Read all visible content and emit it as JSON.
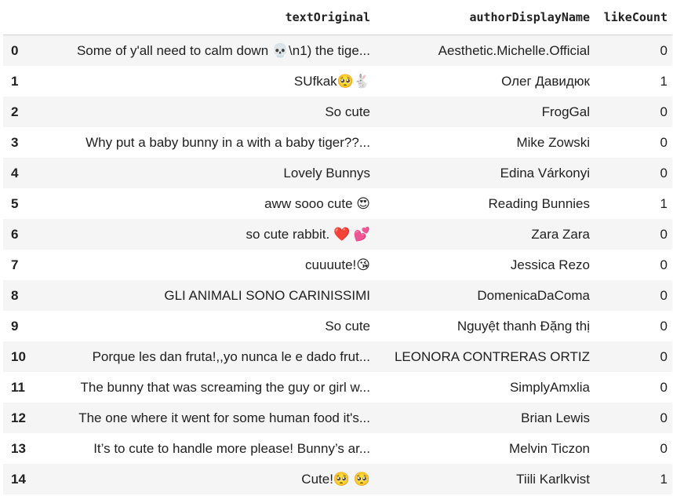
{
  "columns": {
    "index": "",
    "text": "textOriginal",
    "author": "authorDisplayName",
    "likes": "likeCount"
  },
  "rows": [
    {
      "index": "0",
      "text": "Some of y'all need to calm down 💀\\n1) the tige...",
      "author": "Aesthetic.Michelle.Official",
      "likes": "0"
    },
    {
      "index": "1",
      "text": "SUfkak🥺🐇",
      "author": "Олег Давидюк",
      "likes": "1"
    },
    {
      "index": "2",
      "text": "So cute",
      "author": "FrogGal",
      "likes": "0"
    },
    {
      "index": "3",
      "text": "Why put a baby bunny in a with a baby tiger??...",
      "author": "Mike Zowski",
      "likes": "0"
    },
    {
      "index": "4",
      "text": "Lovely Bunnys",
      "author": "Edina Várkonyi",
      "likes": "0"
    },
    {
      "index": "5",
      "text": "aww sooo cute 😍",
      "author": "Reading Bunnies",
      "likes": "1"
    },
    {
      "index": "6",
      "text": "so cute rabbit. ❤️ 💕",
      "author": "Zara Zara",
      "likes": "0"
    },
    {
      "index": "7",
      "text": "cuuuute!😘",
      "author": "Jessica Rezo",
      "likes": "0"
    },
    {
      "index": "8",
      "text": "GLI ANIMALI SONO CARINISSIMI",
      "author": "DomenicaDaComa",
      "likes": "0"
    },
    {
      "index": "9",
      "text": "So cute",
      "author": "Nguyệt thanh Đặng thị",
      "likes": "0"
    },
    {
      "index": "10",
      "text": "Porque les dan fruta!,,yo nunca le e dado frut...",
      "author": "LEONORA CONTRERAS ORTIZ",
      "likes": "0"
    },
    {
      "index": "11",
      "text": "The bunny that was screaming the guy or girl w...",
      "author": "SimplyAmxlia",
      "likes": "0"
    },
    {
      "index": "12",
      "text": "The one where it went for some human food it's...",
      "author": "Brian Lewis",
      "likes": "0"
    },
    {
      "index": "13",
      "text": "It’s to cute to handle more please! Bunny’s ar...",
      "author": "Melvin Ticzon",
      "likes": "0"
    },
    {
      "index": "14",
      "text": "Cute!🥺 🥺",
      "author": "Tiili Karlkvist",
      "likes": "1"
    }
  ]
}
